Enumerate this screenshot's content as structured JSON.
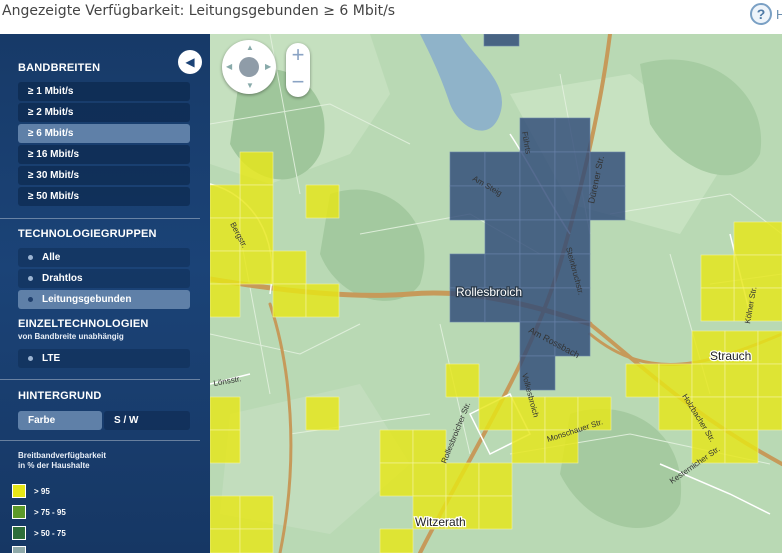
{
  "header": {
    "title": "Angezeigte Verfügbarkeit: Leitungsgebunden ≥ 6 Mbit/s",
    "help_icon": "help-icon",
    "help_glyph": "?",
    "help_text": "H"
  },
  "sidebar": {
    "collapse_glyph": "◀",
    "bandbreiten": {
      "title": "BANDBREITEN",
      "items": [
        "≥ 1 Mbit/s",
        "≥ 2 Mbit/s",
        "≥ 6 Mbit/s",
        "≥ 16 Mbit/s",
        "≥ 30 Mbit/s",
        "≥ 50 Mbit/s"
      ],
      "active_index": 2
    },
    "technologiegruppen": {
      "title": "TECHNOLOGIEGRUPPEN",
      "items": [
        "Alle",
        "Drahtlos",
        "Leitungsgebunden"
      ],
      "active_index": 2
    },
    "einzeltechnologien": {
      "title": "EINZELTECHNOLOGIEN",
      "subtitle": "von Bandbreite unabhängig",
      "items": [
        "LTE"
      ]
    },
    "hintergrund": {
      "title": "HINTERGRUND",
      "options": [
        "Farbe",
        "S / W"
      ],
      "active_index": 0
    },
    "legend": {
      "title_line1": "Breitbandverfügbarkeit",
      "title_line2": "in % der Haushalte",
      "items": [
        {
          "label": "> 95",
          "color": "#e6e617"
        },
        {
          "label": "> 75 - 95",
          "color": "#5d9a2a"
        },
        {
          "label": "> 50 - 75",
          "color": "#2e6e3a"
        },
        {
          "label": "",
          "color": "#8fa9a9"
        }
      ]
    }
  },
  "map": {
    "zoom_in": "+",
    "zoom_out": "−",
    "labels": {
      "rollesbroich": "Rollesbroich",
      "strauch": "Strauch",
      "witzerath": "Witzerath",
      "arn_steig": "Am Steig",
      "fuhrts": "Führts",
      "durener": "Dürener Str.",
      "steinbruch": "Steinbruchstr.",
      "am_rossbach": "Am Rossbach",
      "volkesbroich": "Volkesbroich",
      "monschauer": "Monschauer Str.",
      "rollesbroicher": "Rollesbroicher Str.",
      "holzbach": "Holzbacher Str.",
      "kesternicher": "Kesternicher Str.",
      "bergstr": "Bergstr.",
      "lonsstr": "Lönsstr.",
      "kolner": "Kölner Str."
    },
    "colors": {
      "yellow": "#e6e617",
      "blue": "#2f4a78",
      "base": "#b9d9b4",
      "road": "#c69a5a"
    }
  }
}
